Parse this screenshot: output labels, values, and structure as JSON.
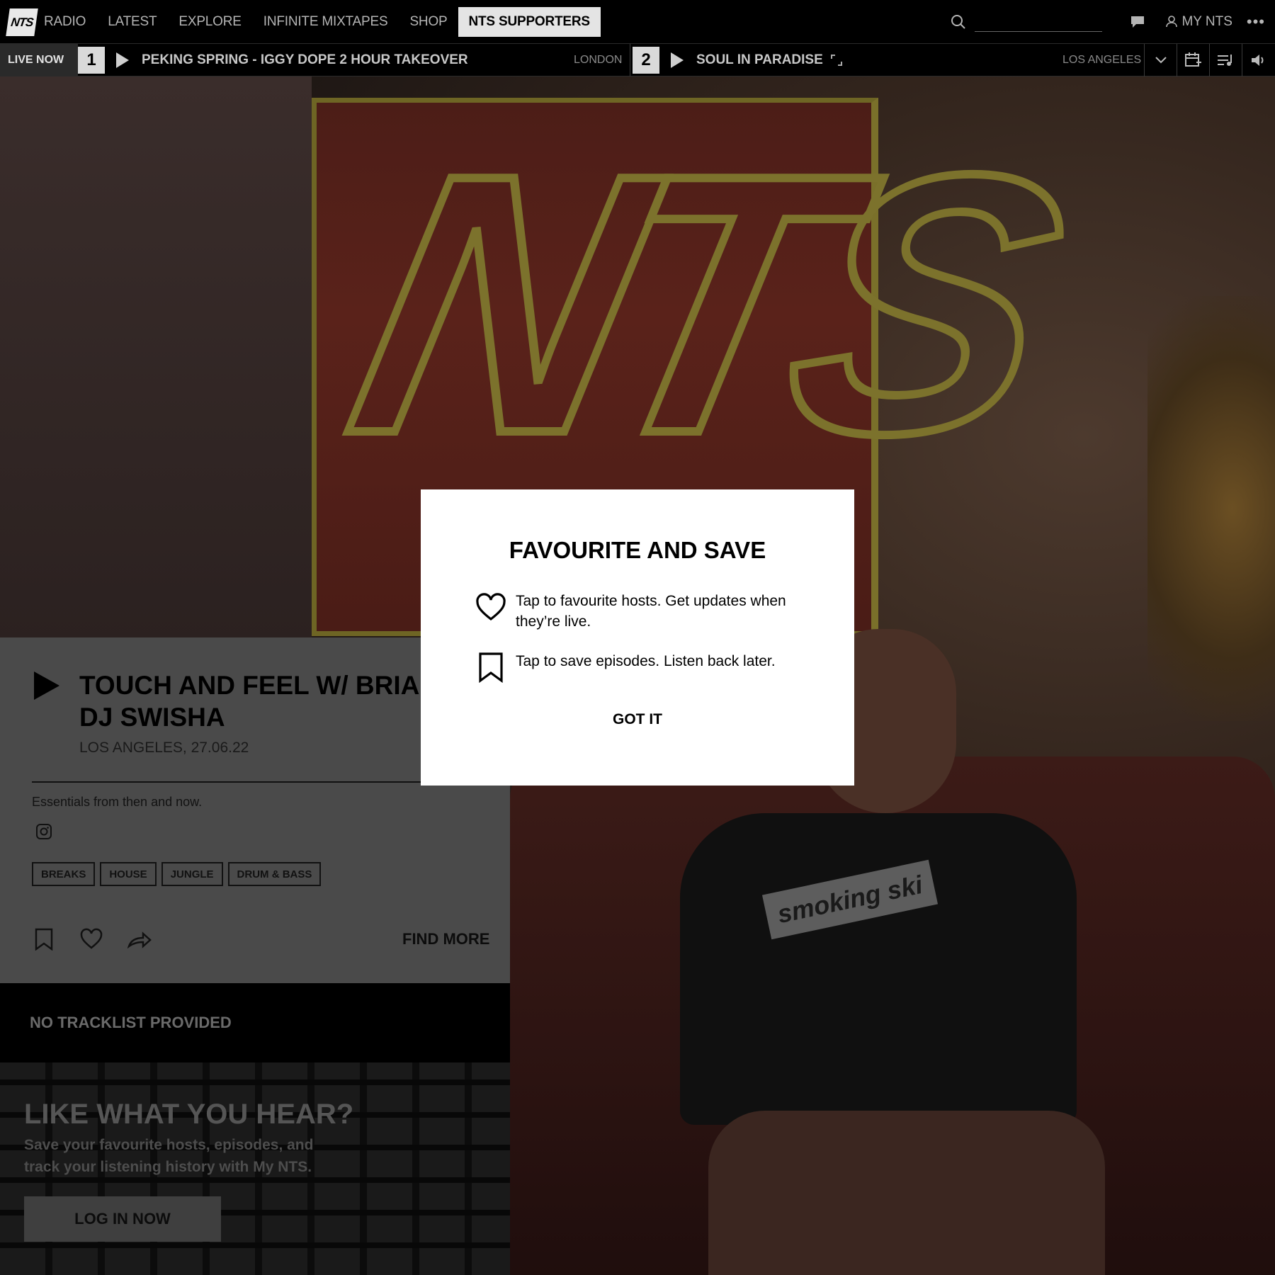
{
  "header": {
    "logo_text": "NTS",
    "nav": [
      {
        "label": "RADIO"
      },
      {
        "label": "LATEST"
      },
      {
        "label": "EXPLORE"
      },
      {
        "label": "INFINITE MIXTAPES"
      },
      {
        "label": "SHOP"
      },
      {
        "label": "NTS SUPPORTERS"
      }
    ],
    "search_placeholder": "",
    "account_label": "MY NTS",
    "more_icon": "more-icon"
  },
  "livebar": {
    "label": "LIVE NOW",
    "channels": [
      {
        "number": "1",
        "title": "PEKING SPRING - IGGY DOPE 2 HOUR TAKEOVER",
        "location": "LONDON"
      },
      {
        "number": "2",
        "title": "SOUL IN PARADISE",
        "location": "LOS ANGELES"
      }
    ]
  },
  "episode": {
    "title": "TOUCH AND FEEL W/ BRIAN V & DJ SWISHA",
    "meta": "LOS ANGELES, 27.06.22",
    "description": "Essentials from then and now.",
    "tags": [
      "BREAKS",
      "HOUSE",
      "JUNGLE",
      "DRUM & BASS"
    ],
    "find_more": "FIND MORE"
  },
  "tracklist": {
    "empty_text": "NO TRACKLIST PROVIDED"
  },
  "promo": {
    "title": "LIKE WHAT YOU HEAR?",
    "subtitle": "Save your favourite hosts, episodes, and track your listening history with My NTS.",
    "button": "LOG IN NOW"
  },
  "hero": {
    "shirt_text": "smoking ski"
  },
  "modal": {
    "title": "FAVOURITE AND SAVE",
    "favourite_text": "Tap to favourite hosts. Get updates when they’re live.",
    "save_text": "Tap to save episodes. Listen back later.",
    "button": "GOT IT"
  }
}
